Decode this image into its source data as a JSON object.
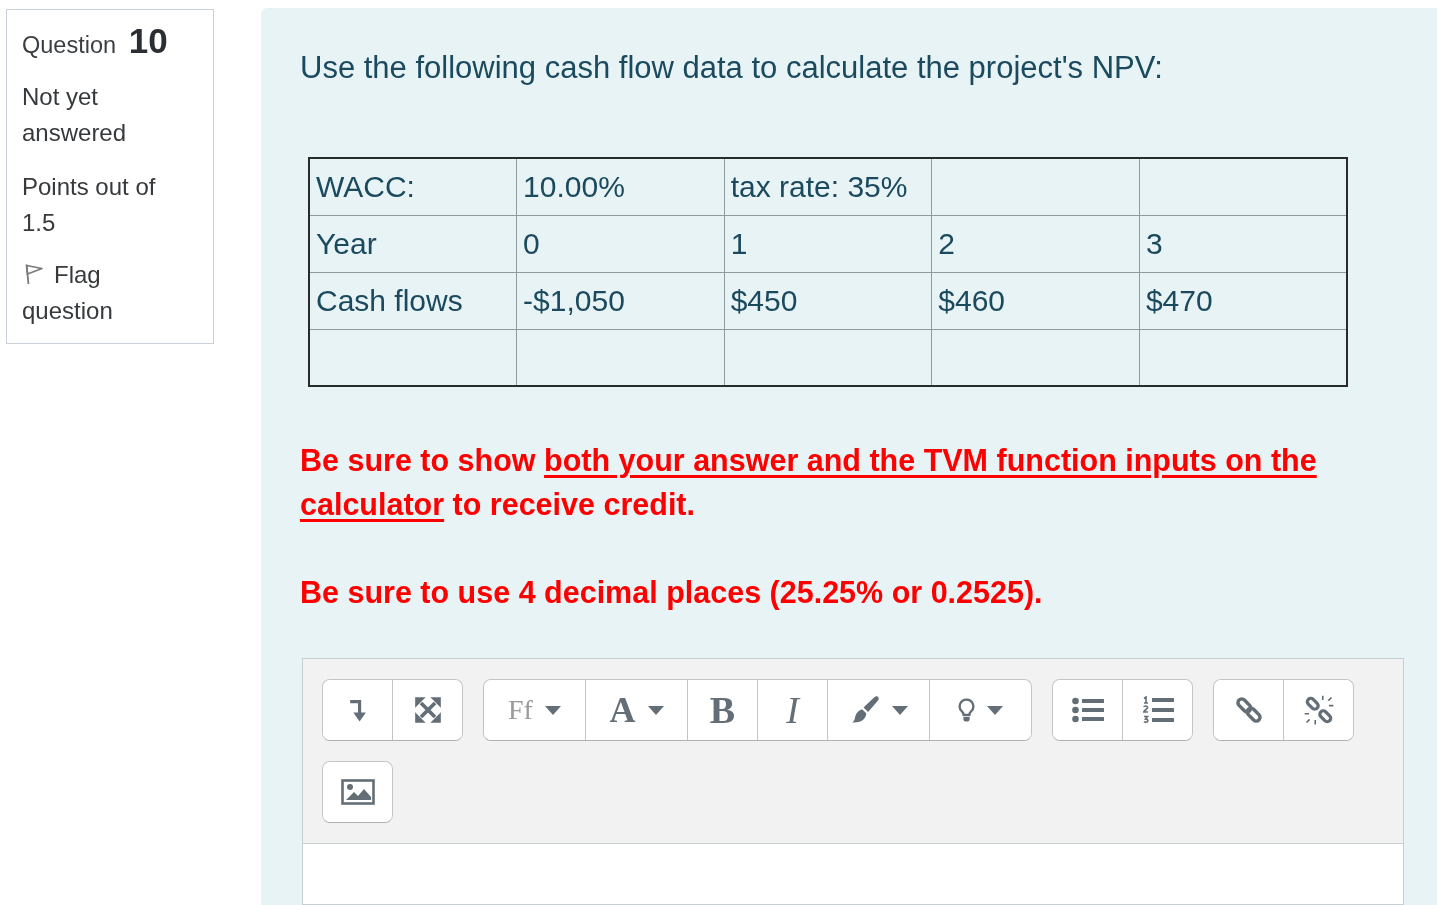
{
  "question_info": {
    "label": "Question",
    "number": "10",
    "status": "Not yet answered",
    "points": "Points out of 1.5",
    "flag": {
      "label": "Flag question",
      "flagged": false
    }
  },
  "question_text": "Use the following cash flow data to calculate the project's NPV:",
  "table": {
    "rows": [
      [
        "WACC:",
        "10.00%",
        "tax rate: 35%",
        null,
        null
      ],
      [
        "Year",
        "0",
        "1",
        "2",
        "3"
      ],
      [
        "Cash flows",
        "-$1,050",
        "$450",
        "$460",
        "$470"
      ],
      [
        null,
        null,
        null,
        null,
        null
      ]
    ]
  },
  "notes": [
    {
      "parts": [
        {
          "text": "Be sure to show ",
          "underline": false
        },
        {
          "text": "both your answer and the TVM function inputs on the calculator",
          "underline": true
        },
        {
          "text": " to receive credit.",
          "underline": false
        }
      ]
    },
    {
      "parts": [
        {
          "text": "Be sure to use 4 decimal places (25.25% or 0.2525).",
          "underline": false
        }
      ]
    }
  ],
  "editor": {
    "toolbar_rows": [
      [
        [
          {
            "kind": "icon",
            "dropdown": false
          },
          {
            "kind": "icon",
            "dropdown": false
          }
        ],
        [
          {
            "kind": "text",
            "label": "Ff",
            "dropdown": true
          },
          {
            "kind": "text",
            "label": "A",
            "dropdown": true
          },
          {
            "kind": "text",
            "label": "B",
            "dropdown": false
          },
          {
            "kind": "text",
            "label": "I",
            "dropdown": false
          },
          {
            "kind": "icon",
            "dropdown": true
          },
          {
            "kind": "icon",
            "dropdown": true
          }
        ],
        [
          {
            "kind": "icon",
            "dropdown": false
          },
          {
            "kind": "icon",
            "dropdown": false
          }
        ],
        [
          {
            "kind": "icon",
            "dropdown": false
          },
          {
            "kind": "icon",
            "dropdown": false
          }
        ]
      ],
      [
        [
          {
            "kind": "icon",
            "dropdown": false
          }
        ]
      ]
    ]
  }
}
